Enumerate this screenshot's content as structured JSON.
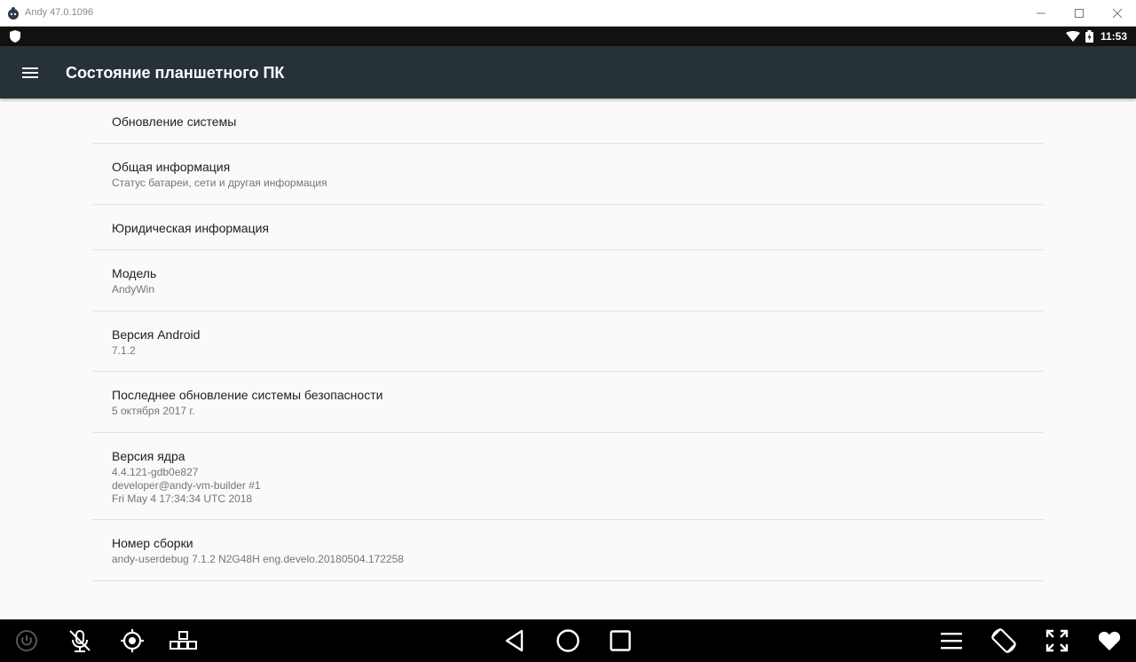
{
  "window": {
    "title": "Andy 47.0.1096"
  },
  "status_bar": {
    "time": "11:53"
  },
  "app_bar": {
    "title": "Состояние планшетного ПК"
  },
  "items": [
    {
      "title": "Обновление системы"
    },
    {
      "title": "Общая информация",
      "subtitle": "Статус батареи, сети и другая информация"
    },
    {
      "title": "Юридическая информация"
    },
    {
      "title": "Модель",
      "subtitle": "AndyWin"
    },
    {
      "title": "Версия Android",
      "subtitle": "7.1.2"
    },
    {
      "title": "Последнее обновление системы безопасности",
      "subtitle": "5 октября 2017 г."
    },
    {
      "title": "Версия ядра",
      "subtitle": "4.4.121-gdb0e827\ndeveloper@andy-vm-builder #1\nFri May 4 17:34:34 UTC 2018"
    },
    {
      "title": "Номер сборки",
      "subtitle": "andy-userdebug 7.1.2 N2G48H eng.develo.20180504.172258"
    }
  ],
  "colors": {
    "app_bar": "#263238",
    "status_bar": "#111111",
    "nav_bar": "#000000",
    "background": "#fafafa"
  },
  "icons": {
    "menu": "hamburger-icon",
    "back": "back-triangle-icon",
    "home": "home-circle-icon",
    "recents": "recents-square-icon"
  }
}
